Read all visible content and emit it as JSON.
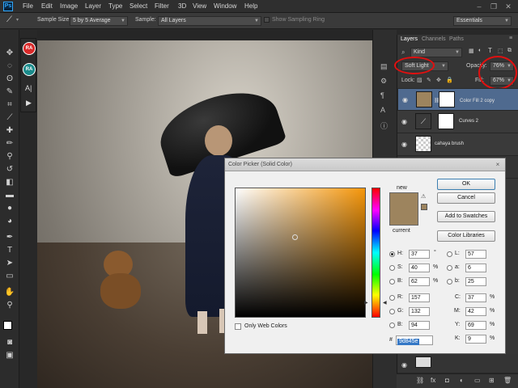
{
  "app": {
    "logo": "Ps",
    "accent": "#31a8ff"
  },
  "menu": [
    "File",
    "Edit",
    "Image",
    "Layer",
    "Type",
    "Select",
    "Filter",
    "3D",
    "View",
    "Window",
    "Help"
  ],
  "options": {
    "sample_size_label": "Sample Size:",
    "sample_size_value": "5 by 5 Average",
    "sample_label": "Sample:",
    "sample_value": "All Layers",
    "show_ring_label": "Show Sampling Ring",
    "workspace": "Essentials"
  },
  "layers_panel": {
    "tabs": [
      "Layers",
      "Channels",
      "Paths"
    ],
    "filter": "Kind",
    "blend_mode": "Soft Light",
    "opacity_label": "Opacity:",
    "opacity_value": "76%",
    "fill_label": "Fill:",
    "fill_value": "67%",
    "lock_label": "Lock:",
    "layers": [
      {
        "name": "Color Fill 2 copy",
        "selected": true
      },
      {
        "name": "Curves 2",
        "selected": false
      },
      {
        "name": "cahaya brush",
        "selected": false
      }
    ]
  },
  "dialog": {
    "title": "Color Picker (Solid Color)",
    "close_icon": "×",
    "new_label": "new",
    "current_label": "current",
    "color": "#9d845e",
    "buttons": {
      "ok": "OK",
      "cancel": "Cancel",
      "add_to_swatches": "Add to Swatches",
      "color_libraries": "Color Libraries"
    },
    "hsb": {
      "h_label": "H:",
      "h_value": "37",
      "h_unit": "°",
      "s_label": "S:",
      "s_value": "40",
      "s_unit": "%",
      "b_label": "B:",
      "b_value": "62",
      "b_unit": "%"
    },
    "lab": {
      "l_label": "L:",
      "l_value": "57",
      "a_label": "a:",
      "a_value": "6",
      "b_label": "b:",
      "b_value": "25"
    },
    "rgb": {
      "r_label": "R:",
      "r_value": "157",
      "g_label": "G:",
      "g_value": "132",
      "b_label": "B:",
      "b_value": "94"
    },
    "cmyk": {
      "c_label": "C:",
      "c_value": "37",
      "m_label": "M:",
      "m_value": "42",
      "y_label": "Y:",
      "y_value": "69",
      "k_label": "K:",
      "k_value": "9",
      "unit": "%"
    },
    "hex_label": "#",
    "hex_value": "9d845e",
    "only_web_colors": "Only Web Colors"
  },
  "toolbar_badges": [
    "RA",
    "RA"
  ],
  "bottom_icons": [
    "link-icon",
    "fx-icon",
    "mask-icon",
    "adjustment-icon",
    "folder-icon",
    "new-layer-icon",
    "trash-icon"
  ]
}
